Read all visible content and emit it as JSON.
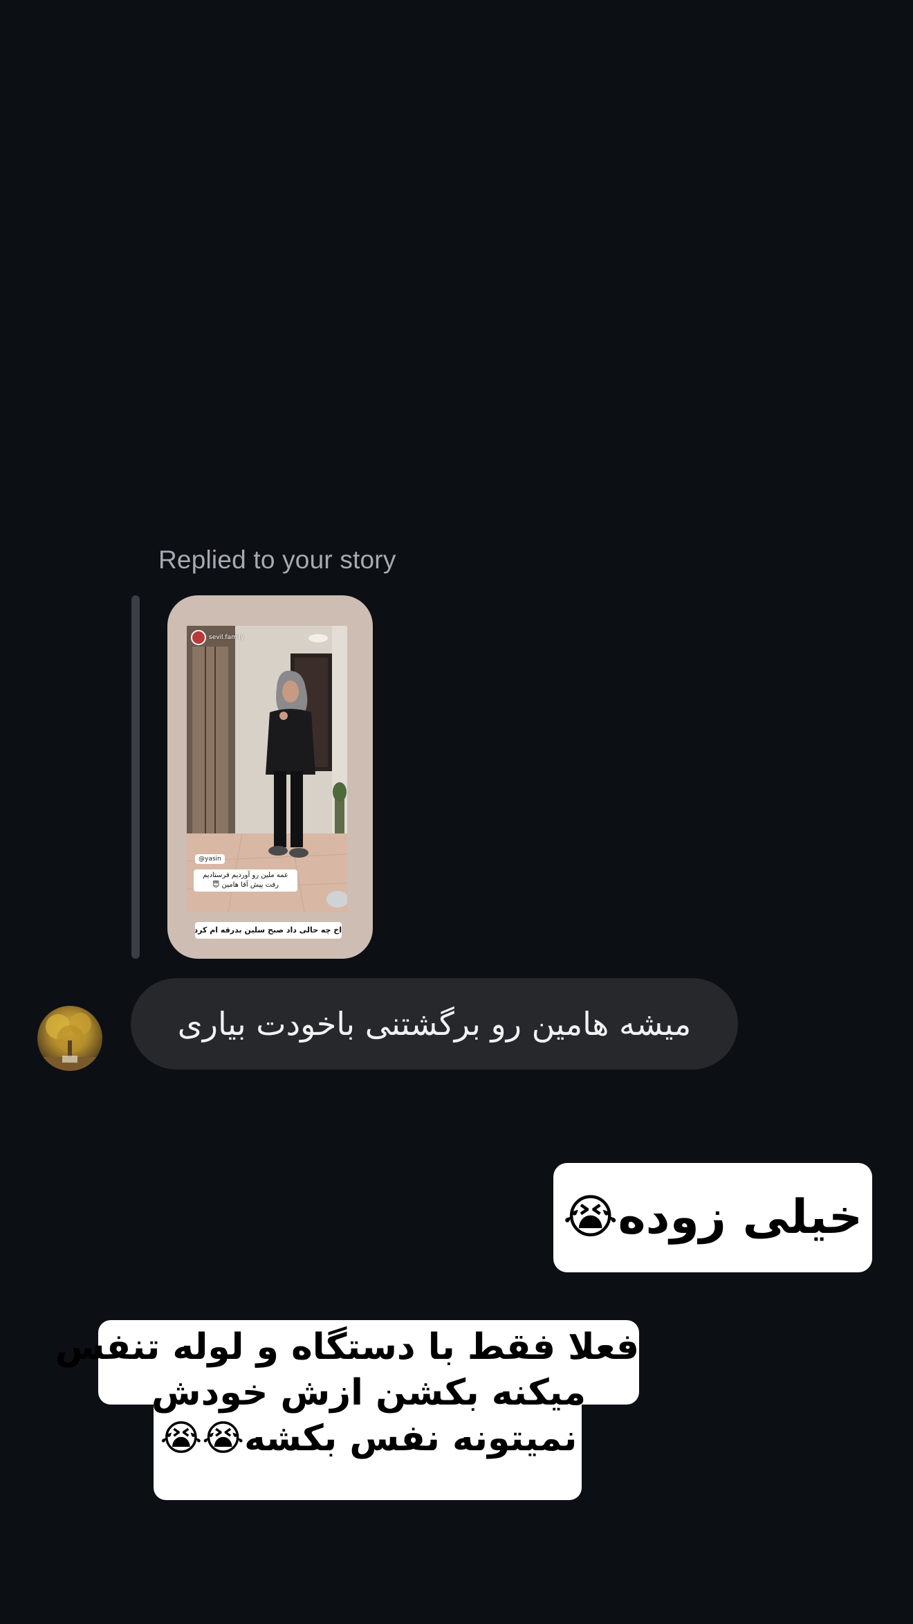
{
  "thread": {
    "reply_caption": "Replied to your story",
    "story": {
      "account_name": "sevil.family",
      "mention": "@yasin",
      "overlay_text": "عمه ملین رو آوردیم فرستادیم رفت پیش آقا هامین 😇",
      "bottom_caption": "اخ چه حالی داد صبح سلین بدرقه ام کرد 🥹🥹"
    },
    "incoming_message": {
      "text": "میشه هامین رو برگشتنی باخودت بیاری"
    },
    "outgoing_stickers": [
      {
        "text": "خیلی زوده😭"
      },
      {
        "lines": [
          "فعلا فقط با دستگاه و لوله تنفس",
          "میکنه بکشن ازش خودش",
          "نمیتونه نفس بکشه😭😭"
        ]
      }
    ]
  },
  "colors": {
    "background": "#0c0f14",
    "incoming_bubble": "#26282c",
    "reply_bar": "#3b3e44",
    "caption_text": "#a7aab0",
    "sticker_bg": "#ffffff"
  }
}
